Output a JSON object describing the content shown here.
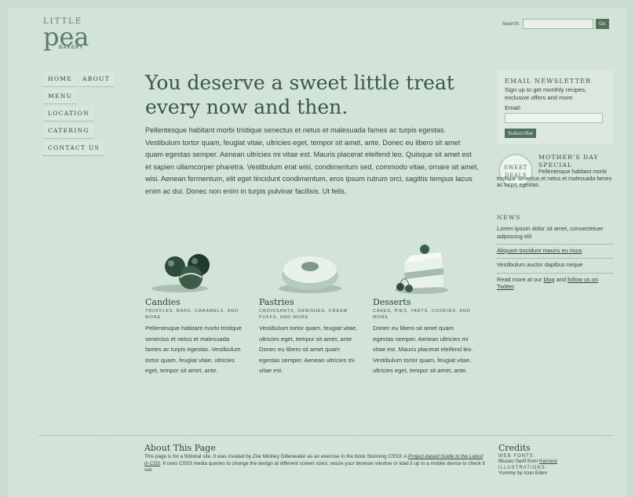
{
  "logo": {
    "little": "LITTLE",
    "pea": "pea",
    "bakery": "BAKERY"
  },
  "search": {
    "label": "Search:",
    "button": "Go"
  },
  "nav": {
    "home": "HOME",
    "about": "ABOUT",
    "menu": "MENU",
    "location": "LOCATION",
    "catering": "CATERING",
    "contact": "CONTACT US"
  },
  "main": {
    "headline": "You deserve a sweet little treat every now and then.",
    "intro": "Pellentesque habitant morbi tristique senectus et netus et malesuada fames ac turpis egestas. Vestibulum tortor quam, feugiat vitae, ultricies eget, tempor sit amet, ante. Donec eu libero sit amet quam egestas semper. Aenean ultricies mi vitae est. Mauris placerat eleifend leo. Quisque sit amet est et sapien ullamcorper pharetra. Vestibulum erat wisi, condimentum sed, commodo vitae, ornare sit amet, wisi. Aenean fermentum, elit eget tincidunt condimentum, eros ipsum rutrum orci, sagittis tempus lacus enim ac dui. Donec non enim in turpis pulvinar facilisis. Ut felis."
  },
  "products": [
    {
      "title": "Candies",
      "sub": "TRUFFLES, BARS, CARAMELS, AND MORE",
      "text": "Pellentesque habitant morbi tristique senectus et netus et malesuada fames ac turpis egestas. Vestibulum tortor quam, feugiat vitae, ultricies eget, tempor sit amet, ante."
    },
    {
      "title": "Pastries",
      "sub": "CROISSANTS, DANISHES, CREAM PUFFS, AND MORE",
      "text": "Vestibulum tortor quam, feugiat vitae, ultricies eget, tempor sit amet, ante Donec eu libero sit amet quam egestas semper. Aenean ultricies mi vitae est."
    },
    {
      "title": "Desserts",
      "sub": "CAKES, PIES, TARTS, COOKIES, AND MORE",
      "text": "Donec eu libero sit amet quam egestas semper. Aenean ultricies mi vitae est. Mauris placerat eleifend leo. Vestibulum tortor quam, feugiat vitae, ultricies eget, tempor sit amet, ante."
    }
  ],
  "newsletter": {
    "title": "EMAIL NEWSLETTER",
    "text": "Sign up to get monthly recipes, exclusive offers and more.",
    "email_label": "Email:",
    "button": "Subscribe"
  },
  "deal": {
    "badge_line1": "SWEET",
    "badge_line2": "DEALS",
    "title": "MOTHER'S DAY SPECIAL",
    "text": "Pellentesque habitant morbi tristique senectus et netus et malesuada fames ac turpis egestas."
  },
  "news": {
    "title": "NEWS",
    "items": [
      "Lorem ipsum dolor sit amet, consectetuer adipiscing elit",
      "Aliquam tincidunt mauris eu risus",
      "Vestibulum auctor dapibus neque"
    ],
    "more_prefix": "Read more at our",
    "blog": "blog",
    "and": "and",
    "follow": "follow us on Twitter",
    "period": "."
  },
  "footer": {
    "about_title": "About This Page",
    "about_p1": "This page is for a fictional site. It was created by Zoe Mickley Gillenwater as an exercise in the book Stunning CSS3: A",
    "about_link": "Project-based Guide to the Latest in CSS",
    "about_p2": ". It uses CSS3 media queries to change the design at different screen sizes; resize your browser window or load it up in a mobile device to check it out.",
    "credits_title": "Credits",
    "web_fonts_label": "WEB FONTS:",
    "web_fonts_value_prefix": "Museo Serif from",
    "web_fonts_link": "Kernest",
    "illustrations_label": "ILLUSTRATIONS:",
    "illustrations_value": "Yummy by Icon Eden"
  }
}
